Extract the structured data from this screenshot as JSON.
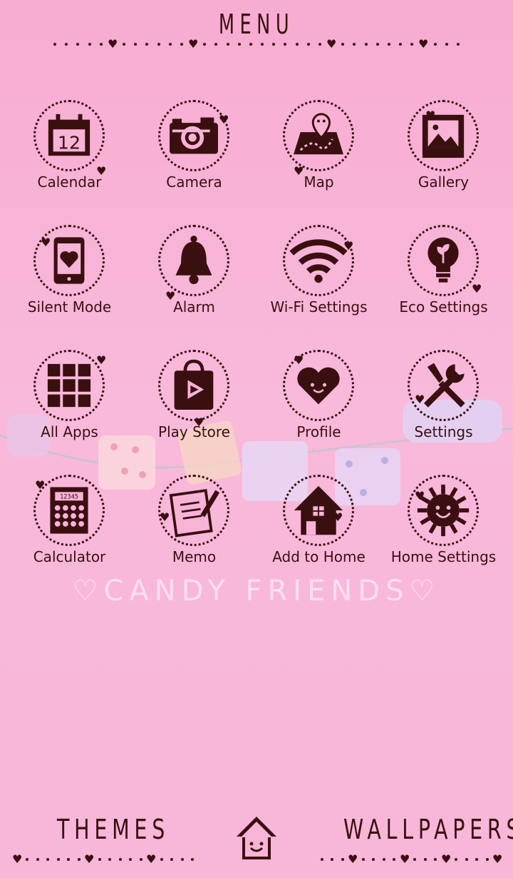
{
  "header": {
    "title": "MENU"
  },
  "apps": [
    {
      "label": "Calendar",
      "icon": "calendar-icon"
    },
    {
      "label": "Camera",
      "icon": "camera-icon"
    },
    {
      "label": "Map",
      "icon": "map-icon"
    },
    {
      "label": "Gallery",
      "icon": "gallery-icon"
    },
    {
      "label": "Silent Mode",
      "icon": "phone-heart-icon"
    },
    {
      "label": "Alarm",
      "icon": "bell-icon"
    },
    {
      "label": "Wi-Fi Settings",
      "icon": "wifi-icon"
    },
    {
      "label": "Eco Settings",
      "icon": "lightbulb-icon"
    },
    {
      "label": "All Apps",
      "icon": "grid-icon"
    },
    {
      "label": "Play Store",
      "icon": "play-store-icon"
    },
    {
      "label": "Profile",
      "icon": "heart-face-icon"
    },
    {
      "label": "Settings",
      "icon": "tools-icon"
    },
    {
      "label": "Calculator",
      "icon": "calculator-icon"
    },
    {
      "label": "Memo",
      "icon": "memo-icon"
    },
    {
      "label": "Add to Home",
      "icon": "house-icon"
    },
    {
      "label": "Home Settings",
      "icon": "sun-icon"
    }
  ],
  "calendar_day": "12",
  "calculator_display": "12345",
  "watermark": "♡CANDY FRIENDS♡",
  "footer": {
    "left_label": "THEMES",
    "right_label": "WALLPAPERS",
    "center_icon": "home-face-icon"
  },
  "colors": {
    "background": "#f8b3d6",
    "ink": "#3a0f10"
  }
}
